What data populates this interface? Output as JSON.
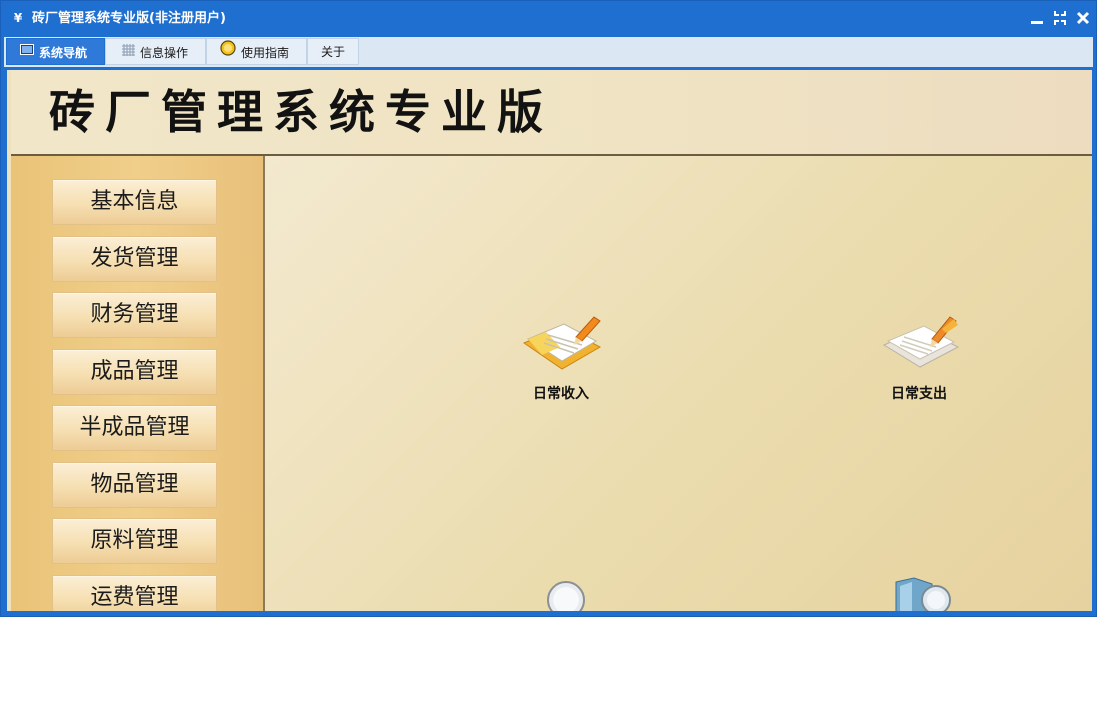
{
  "window": {
    "title": "砖厂管理系统专业版(非注册用户)"
  },
  "tabs": [
    {
      "label": "系统导航",
      "icon": "monitor-icon"
    },
    {
      "label": "信息操作",
      "icon": "grid-icon"
    },
    {
      "label": "使用指南",
      "icon": "help-circle-icon"
    },
    {
      "label": "关于",
      "icon": ""
    }
  ],
  "banner": {
    "title": "砖厂管理系统专业版"
  },
  "sidebar": {
    "items": [
      {
        "label": "基本信息"
      },
      {
        "label": "发货管理"
      },
      {
        "label": "财务管理"
      },
      {
        "label": "成品管理"
      },
      {
        "label": "半成品管理"
      },
      {
        "label": "物品管理"
      },
      {
        "label": "原料管理"
      },
      {
        "label": "运费管理"
      }
    ]
  },
  "main": {
    "tools": [
      {
        "label": "日常收入",
        "icon": "notebook-pencil-icon"
      },
      {
        "label": "日常支出",
        "icon": "papers-pencil-icon"
      },
      {
        "label": "",
        "icon": "magnifier-icon"
      },
      {
        "label": "",
        "icon": "map-magnifier-icon"
      }
    ]
  },
  "colors": {
    "titlebar": "#1e6fd0",
    "sidebar": "#eec784",
    "content": "#efe3bf"
  }
}
